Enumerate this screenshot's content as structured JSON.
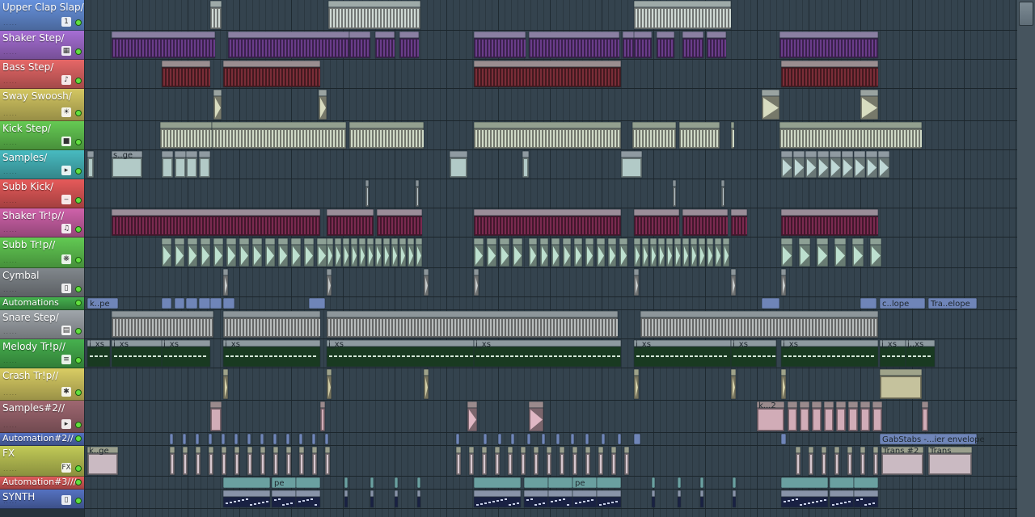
{
  "tracks": [
    {
      "name": "Upper Clap Slap/",
      "icon": "1",
      "color": "#5a7fc0",
      "size": "full"
    },
    {
      "name": "Shaker Step/",
      "icon": "▦",
      "color": "#9060b8",
      "size": "full"
    },
    {
      "name": "Bass Step/",
      "icon": "♪",
      "color": "#c85a5a",
      "size": "full"
    },
    {
      "name": "Sway Swoosh/",
      "icon": "☀",
      "color": "#b8ad55",
      "size": "full"
    },
    {
      "name": "Kick Step/",
      "icon": "■",
      "color": "#58b048",
      "size": "full"
    },
    {
      "name": "Samples/",
      "icon": "▸",
      "color": "#3fa3a8",
      "size": "full"
    },
    {
      "name": "Subb Kick/",
      "icon": "‒",
      "color": "#c84e4e",
      "size": "full"
    },
    {
      "name": "Shaker Tr!p//",
      "icon": "♫",
      "color": "#b45594",
      "size": "full"
    },
    {
      "name": "Subb Tr!p//",
      "icon": "❋",
      "color": "#55b048",
      "size": "full"
    },
    {
      "name": "Cymbal",
      "icon": "▯",
      "color": "#70757a",
      "size": "full"
    },
    {
      "name": "Automations",
      "icon": "",
      "color": "#3c9a44",
      "size": "slim"
    },
    {
      "name": "Snare Step/",
      "icon": "▤",
      "color": "#8b9095",
      "size": "full"
    },
    {
      "name": "Melody Tr!p//",
      "icon": "≡",
      "color": "#3d9a44",
      "size": "full"
    },
    {
      "name": "Crash Tr!p//",
      "icon": "✱",
      "color": "#bdb257",
      "size": "full"
    },
    {
      "name": "Samples#2//",
      "icon": "▸",
      "color": "#8a5a62",
      "size": "full"
    },
    {
      "name": "Automation#2//",
      "icon": "",
      "color": "#4a63a8",
      "size": "slim"
    },
    {
      "name": "FX",
      "icon": "FX",
      "color": "#a8b04c",
      "size": "full"
    },
    {
      "name": "Automation#3///",
      "icon": "",
      "color": "#c25050",
      "size": "slim"
    },
    {
      "name": "SYNTH",
      "icon": "▯",
      "color": "#4a63a8",
      "size": "full"
    }
  ],
  "clip_labels": {
    "samples_clip_1": "s..ge",
    "automation_clip_1": "k..pe",
    "automation_clip_2": "c..lope",
    "automation_clip_3": "Tra..elope",
    "melody_clip_label": "j_xs",
    "melody_clip_end": "j,,xs",
    "samples2_clip_1": "k...2",
    "fx_clip_1": "k..ge",
    "fx_clip_2": "Trans #2",
    "fx_clip_3": "Trans",
    "automation2_clip_1": "GabStabs -...ier envelope",
    "automation3_clip_label": "pe"
  },
  "colors": {
    "playlist_bg": "#34434e",
    "grid_line": "#2b3841",
    "bar_line": "#1f2a31",
    "track_bg": "#26333c",
    "led_green": "#62e03e"
  }
}
